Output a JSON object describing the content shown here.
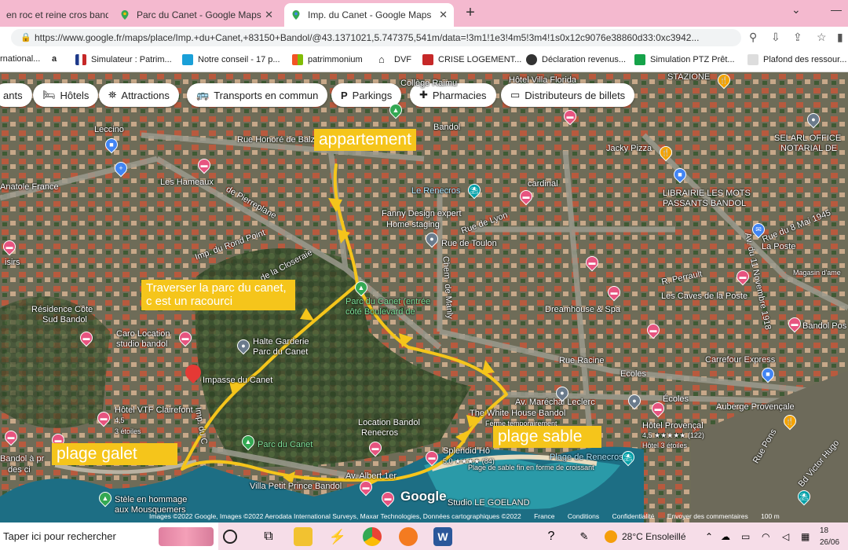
{
  "browser": {
    "tabs": [
      {
        "title": "en roc et reine cros bando...",
        "icon_color": "#4a8f3c"
      },
      {
        "title": "Parc du Canet - Google Maps",
        "icon_color": "#34a853"
      },
      {
        "title": "Imp. du Canet - Google Maps",
        "icon_color": "#34a853"
      }
    ],
    "new_tab_label": "+",
    "url": "https://www.google.fr/maps/place/Imp.+du+Canet,+83150+Bandol/@43.1371021,5.747375,541m/data=!3m1!1e3!4m5!3m4!1s0x12c9076e38860d33:0xc3942...",
    "bookmarks": [
      {
        "label": "rnational...",
        "icon_color": "#e0e0e0"
      },
      {
        "label": "a",
        "icon_color": "#ffffff"
      },
      {
        "label": "Simulateur : Patrim...",
        "icon_color": "#1e3a8a"
      },
      {
        "label": "Notre conseil - 17 p...",
        "icon_color": "#1aa0d8"
      },
      {
        "label": "patrimmonium",
        "icon_color": "#f4a300"
      },
      {
        "label": "DVF",
        "icon_color": "#222222"
      },
      {
        "label": "CRISE LOGEMENT...",
        "icon_color": "#c62828"
      },
      {
        "label": "Déclaration revenus...",
        "icon_color": "#333333"
      },
      {
        "label": "Simulation PTZ Prêt...",
        "icon_color": "#16a34a"
      },
      {
        "label": "Plafond des ressour...",
        "icon_color": "#dddddd"
      }
    ]
  },
  "map": {
    "chips": [
      {
        "label": "ants",
        "icon": ""
      },
      {
        "label": "Hôtels",
        "icon": "bed-icon"
      },
      {
        "label": "Attractions",
        "icon": "attraction-icon"
      },
      {
        "label": "Transports en commun",
        "icon": "bus-icon"
      },
      {
        "label": "Parkings",
        "icon": "parking-icon"
      },
      {
        "label": "Pharmacies",
        "icon": "pharmacy-icon"
      },
      {
        "label": "Distributeurs de billets",
        "icon": "atm-icon"
      }
    ],
    "notes": {
      "appartement": "appartement",
      "traverser": "Traverser la parc du canet, c est un racourci",
      "plage_galet": "plage galet",
      "plage_sable": "plage sable"
    },
    "labels": {
      "leccino": "Leccino",
      "rue_honore": "Rue Honoré de Balz",
      "les_hameaux": "Les Hameaux",
      "anatole": "Anatole France",
      "de_pierreplane": "de Pierreplane",
      "rond_point": "Imp. du Rond Point",
      "closeraie": "de la Closeraie",
      "sisirs": "isirs",
      "residence": "Résidence Côte",
      "sud_bandol": "Sud Bandol",
      "caro": "Caro Location",
      "caro2": "studio bandol",
      "halte": "Halte Garderie",
      "halte2": "Parc du Canet",
      "impasse": "Impasse du Canet",
      "hotel_vtf": "Hôtel VTF Clairefont",
      "vtf_rating": "4,5",
      "vtf_stars": "3 étoiles",
      "imp_canet": "Imp. du C",
      "parc_canet": "Parc du Canet",
      "bandol_pres": "Bandol à pr",
      "des_ci": "des ci",
      "stele": "Stèle en hommage",
      "stele2": "aux Mousquemers",
      "villa": "Villa Petit Prince Bandol",
      "hotel_villa": "Hôtel Villa Florida",
      "college": "Collège Raimu",
      "bandol_top": "Bandol",
      "le_renecros": "Le Renecros",
      "fanny": "Fanny Design expert",
      "fanny2": "Home staging",
      "rue_lyon": "Rue de Lyon",
      "rue_toulon": "Rue de Toulon",
      "chem_manly": "Chem. de Manly",
      "parc_entree": "Parc du Canet (entrée",
      "parc_entree2": "côté Boulevard de",
      "cardinal": "cardinal",
      "jacky": "Jacky Pizza",
      "librairie": "LIBRAIRIE LES MOTS",
      "librairie2": "PASSANTS BANDOL",
      "selarl": "SELARL OFFICE",
      "selarl2": "NOTARIAL DE",
      "stazione": "STAZIONE",
      "rue_8mai": "Rue du 8 Mai 1945",
      "la_poste": "La Poste",
      "caves": "Les Caves de la Poste",
      "dreamhouse": "Dreamhouse & Spa",
      "rue_racine": "Rue Racine",
      "ecoles": "Ecoles",
      "ecoles2": "Écoles",
      "carrefour": "Carrefour Express",
      "bandol_pos": "Bandol Pos",
      "white_house": "The White House Bandol",
      "white_house2": "Ferme temporairement",
      "marechal": "Av. Maréchal Leclerc",
      "auberge": "Auberge Provençale",
      "location_bandol": "Location Bandol",
      "location_bandol2": "Renecros",
      "hotel_provencal": "Hôtel Provençal",
      "provencal_rating": "4,5 ★★★★★ (122)",
      "provencal_stars": "Hôtel 3 étoiles",
      "splendid": "Splendid Hô",
      "splendid_rating": "5,0 ★★★★ (84)",
      "plage_renecros": "Plage de Renecros",
      "plage_renecros2": "Plage de sable fin en forme de croissant",
      "goeland": "Studio LE GOELAND",
      "rue_pons": "Rue Pons",
      "albert": "Av. Albert 1er",
      "magasin": "Magasin d'ame",
      "perrault": "R. Perrault",
      "bd_victor": "Bd Victor Hugo",
      "av_11nov": "Av. du 11 Novembre 1918"
    },
    "attribution": [
      "Images ©2022 Google, Images ©2022 Aerodata International Surveys, Maxar Technologies, Données cartographiques ©2022",
      "France",
      "Conditions",
      "Confidentialité",
      "Envoyer des commentaires",
      "100 m"
    ],
    "google_logo": "Google"
  },
  "taskbar": {
    "search_placeholder": "Taper ici pour rechercher",
    "temperature": "28°C",
    "weather": "Ensoleillé",
    "time": "18",
    "date": "26/06"
  }
}
